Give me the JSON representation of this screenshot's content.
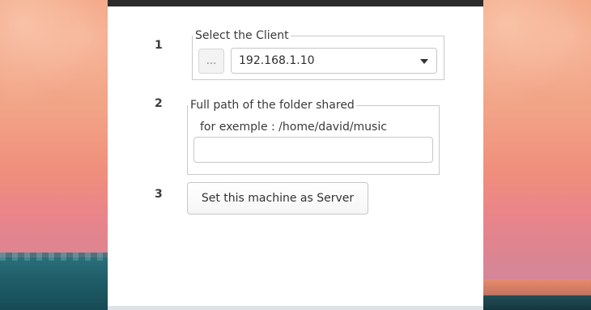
{
  "steps": [
    "1",
    "2",
    "3"
  ],
  "client_group": {
    "legend": "Select the Client",
    "browse_label": "...",
    "selected_client": "192.168.1.10"
  },
  "folder_group": {
    "legend": "Full path of the folder shared",
    "hint": "for exemple : /home/david/music",
    "value": ""
  },
  "server_button_label": "Set this machine as Server",
  "colors": {
    "titlebar": "#2c2c2c",
    "dialog_bg": "#ffffff",
    "border": "#c7c7c7"
  }
}
